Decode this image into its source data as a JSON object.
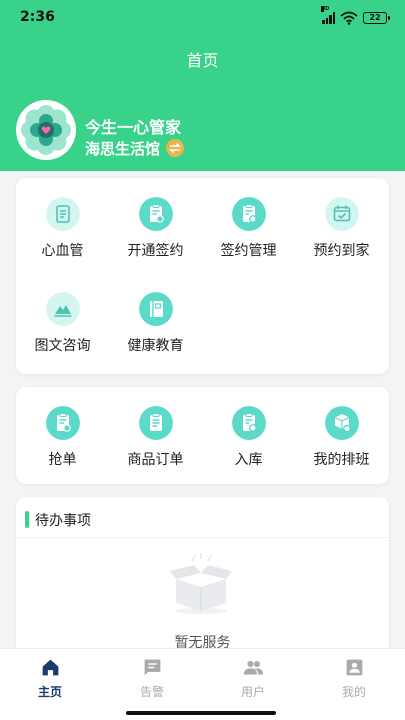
{
  "status_bar": {
    "time": "2:36",
    "network_label": "HD",
    "battery": "22"
  },
  "header": {
    "title": "首页"
  },
  "profile": {
    "name": "今生一心管家",
    "org": "海思生活馆"
  },
  "services": [
    {
      "label": "心血管",
      "icon": "document-icon"
    },
    {
      "label": "开通签约",
      "icon": "clipboard-edit-icon"
    },
    {
      "label": "签约管理",
      "icon": "clipboard-settings-icon"
    },
    {
      "label": "预约到家",
      "icon": "calendar-check-icon"
    },
    {
      "label": "图文咨询",
      "icon": "image-icon"
    },
    {
      "label": "健康教育",
      "icon": "book-icon"
    }
  ],
  "actions": [
    {
      "label": "抢单",
      "icon": "clipboard-edit-icon"
    },
    {
      "label": "商品订单",
      "icon": "clipboard-list-icon"
    },
    {
      "label": "入库",
      "icon": "clipboard-settings-icon"
    },
    {
      "label": "我的排班",
      "icon": "cube-settings-icon"
    }
  ],
  "todo": {
    "title": "待办事项",
    "empty_text": "暂无服务"
  },
  "tabbar": [
    {
      "label": "主页",
      "icon": "home-icon",
      "active": true
    },
    {
      "label": "告警",
      "icon": "message-icon",
      "active": false
    },
    {
      "label": "用户",
      "icon": "users-icon",
      "active": false
    },
    {
      "label": "我的",
      "icon": "person-icon",
      "active": false
    }
  ],
  "colors": {
    "brand": "#39d28a",
    "icon_bg": "#5bd9c9",
    "icon_bg_light": "#d5f5f0",
    "tab_active": "#1e3a6d",
    "tab_inactive": "#aaaaaa"
  }
}
